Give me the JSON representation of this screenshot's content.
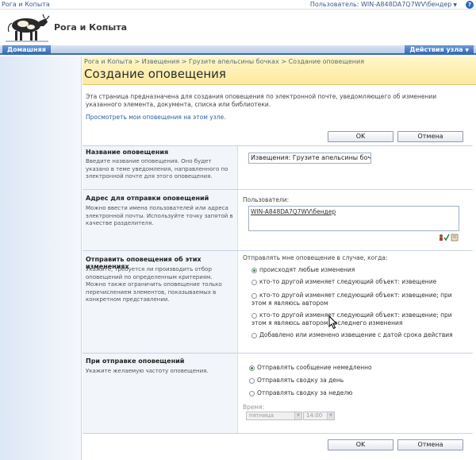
{
  "topbar": {
    "site_name": "Рога и Копыта",
    "user": "Пользователь: WIN-A848DA7Q7WV\\бендер",
    "help": "?"
  },
  "header": {
    "site_title": "Рога и Копыта"
  },
  "nav": {
    "home_tab": "Домашняя",
    "site_actions": "Действия узла"
  },
  "title_area": {
    "breadcrumb": "Рога и Копыта > Извещения > Грузите апельсины бочках > Создание оповещения",
    "page_title": "Создание оповещения"
  },
  "intro": {
    "description": "Эта страница предназначена для создания оповещения по электронной почте, уведомляющего об изменении указанного элемента, документа, списка или библиотеки.",
    "my_alerts_link": "Просмотреть мои оповещения на этом узле."
  },
  "buttons": {
    "ok": "OK",
    "cancel": "Отмена"
  },
  "sections": {
    "alert_title": {
      "title": "Название оповещения",
      "description": "Введите название оповещения. Оно будет указано в теме уведомления, направленного по электронной почте для этого оповещения.",
      "value": "Извещения: Грузите апельсины бочк"
    },
    "send_to": {
      "title": "Адрес для отправки оповещений",
      "description": "Можно ввести имена пользователей или адреса электронной почты. Используйте точку запятой в качестве разделителя.",
      "users_label": "Пользователи:",
      "users_value": "WIN-A848DA7Q7WV\\бендер"
    },
    "change_filter": {
      "title": "Отправить оповещения об этих изменениях",
      "description": "Укажите, требуется ли производить отбор оповещений по определенным критериям. Можно также ограничить оповещение только перечислением элементов, показываемых в конкретном представлении.",
      "prompt": "Отправлять мне оповещение в случае, когда:",
      "options": [
        {
          "label": "происходят любые изменения",
          "selected": true
        },
        {
          "label": "кто-то другой изменяет следующий объект: извещение",
          "selected": false
        },
        {
          "label": "кто-то другой изменяет следующий объект: извещение; при",
          "label2": "этом я являюсь автором",
          "selected": false
        },
        {
          "label": "кто-то другой изменяет следующий объект: извещение; при",
          "label2": "этом я являюсь автором последнего изменения",
          "selected": false
        },
        {
          "label": "Добавлено или изменено извещение с датой срока действия",
          "selected": false
        }
      ]
    },
    "frequency": {
      "title": "При отправке оповещений",
      "description": "Укажите желаемую частоту оповещения.",
      "options": [
        {
          "label": "Отправлять сообщение немедленно",
          "selected": true
        },
        {
          "label": "Отправлять сводку за день",
          "selected": false
        },
        {
          "label": "Отправлять сводку за неделю",
          "selected": false
        }
      ],
      "time_label": "Время:",
      "day_value": "пятница",
      "time_value": "14:00"
    }
  },
  "icons": {
    "help": "help-icon",
    "check_names": "check-names-icon",
    "browse": "address-book-icon",
    "logo": "cow-logo"
  }
}
